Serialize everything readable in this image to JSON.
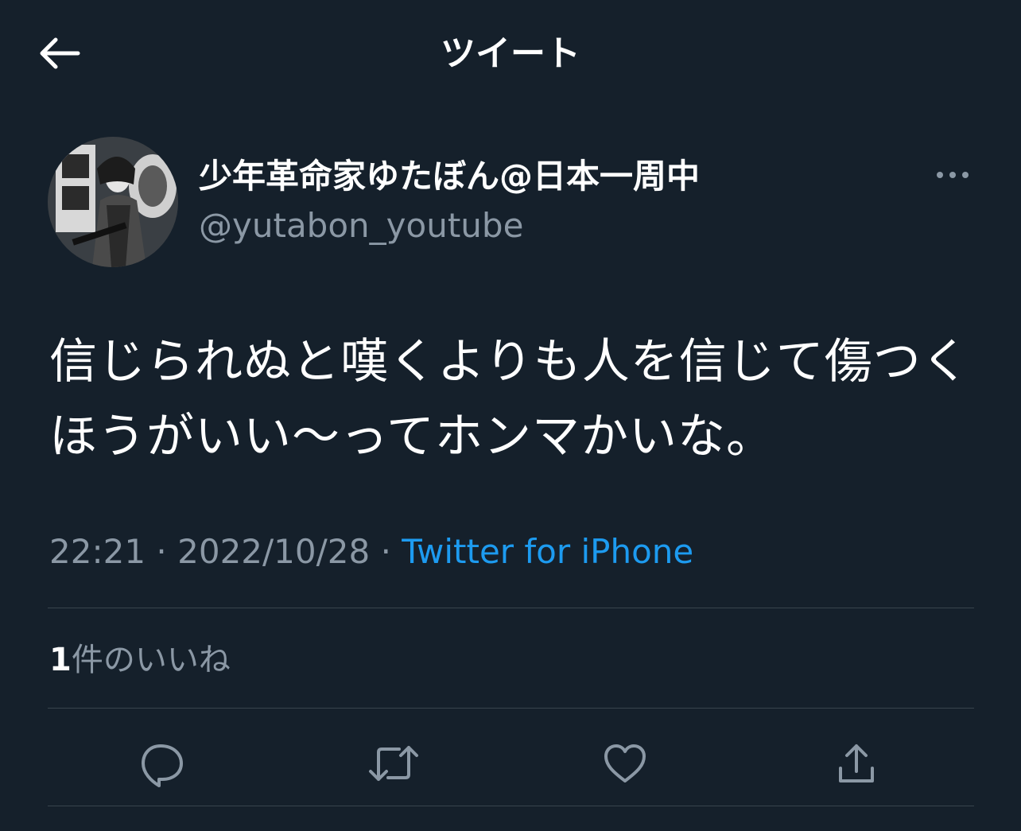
{
  "header": {
    "title": "ツイート"
  },
  "tweet": {
    "display_name": "少年革命家ゆたぼん@日本一周中",
    "username": "@yutabon_youtube",
    "text": "信じられぬと嘆くよりも人を信じて傷つくほうがいい〜ってホンマかいな。",
    "time": "22:21",
    "date": "2022/10/28",
    "separator": "·",
    "source": "Twitter for iPhone",
    "likes_count": "1",
    "likes_label": "件のいいね"
  },
  "icons": {
    "back": "back-arrow-icon",
    "more": "more-icon",
    "reply": "reply-icon",
    "retweet": "retweet-icon",
    "like": "heart-icon",
    "share": "share-icon"
  },
  "colors": {
    "background": "#15202b",
    "text": "#ffffff",
    "secondary": "#8b98a5",
    "accent": "#1d9bf0",
    "divider": "#38444d"
  }
}
